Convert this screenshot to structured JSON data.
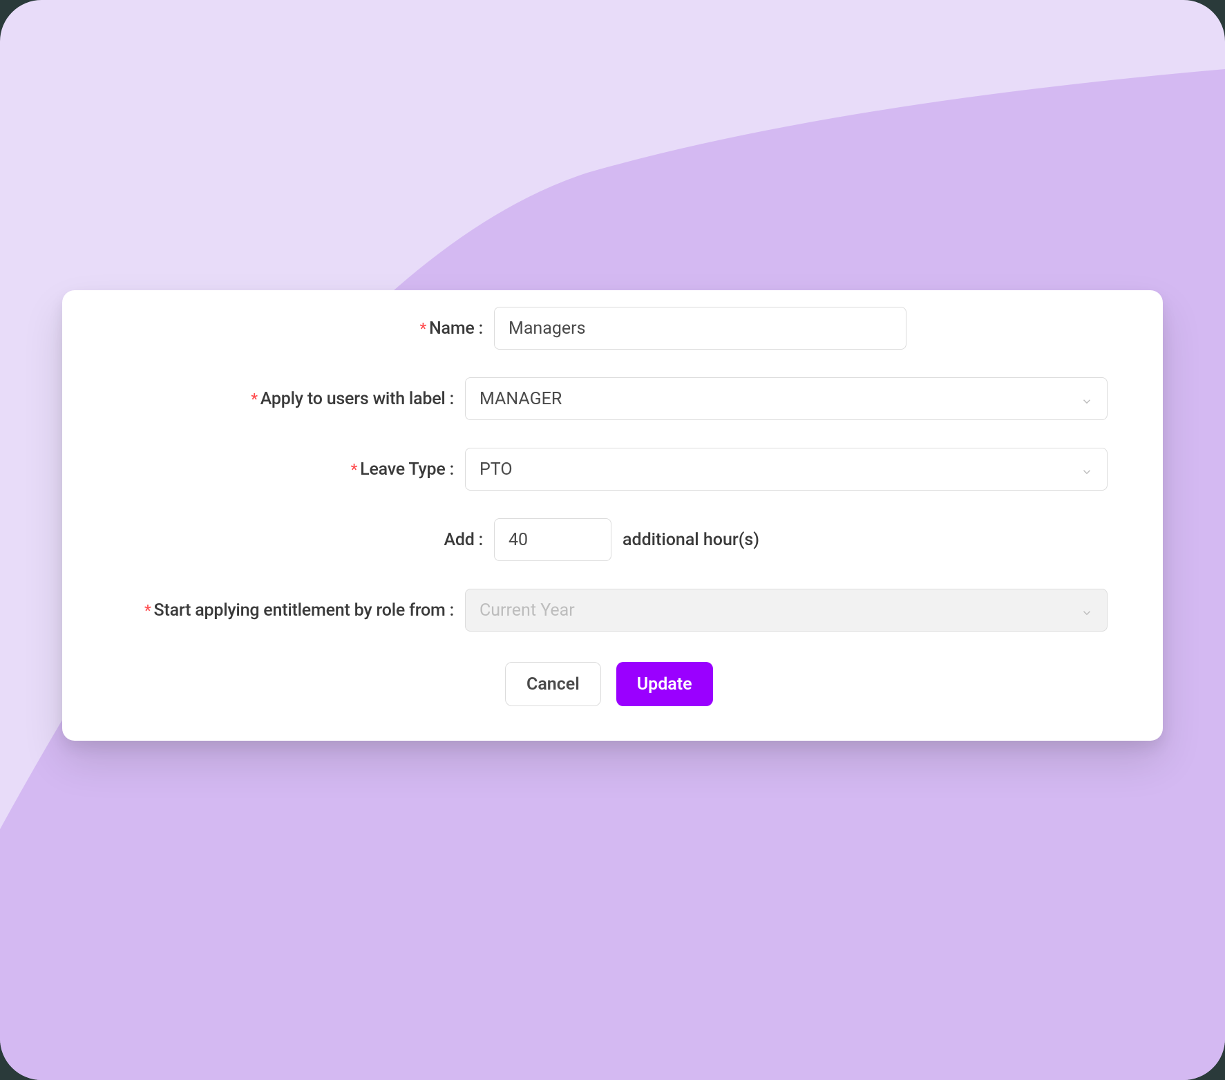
{
  "form": {
    "name": {
      "label": "Name :",
      "value": "Managers",
      "required": true
    },
    "apply_label": {
      "label": "Apply to users with label :",
      "value": "MANAGER",
      "required": true
    },
    "leave_type": {
      "label": "Leave Type :",
      "value": "PTO",
      "required": true
    },
    "add": {
      "label": "Add :",
      "value": "40",
      "suffix": "additional hour(s)",
      "required": false
    },
    "start_from": {
      "label": "Start applying entitlement by role from :",
      "placeholder": "Current Year",
      "required": true
    }
  },
  "buttons": {
    "cancel": "Cancel",
    "update": "Update"
  },
  "required_marker": "*"
}
